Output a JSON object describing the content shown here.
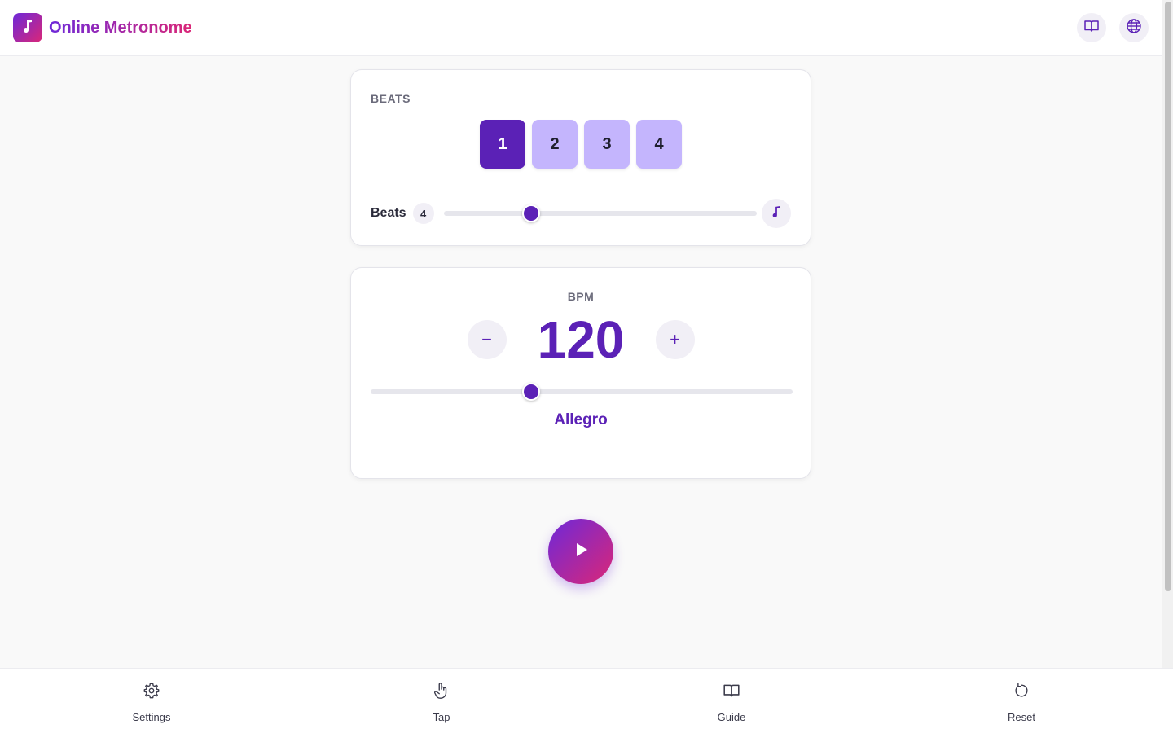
{
  "app": {
    "title": "Online Metronome"
  },
  "header": {
    "icons": [
      "book-icon",
      "globe-icon"
    ]
  },
  "beats_card": {
    "section_label": "BEATS",
    "beats": [
      "1",
      "2",
      "3",
      "4"
    ],
    "active_beat_index": 0,
    "control_label": "Beats",
    "count": "4",
    "slider_level": 0.28
  },
  "bpm_card": {
    "section_label": "BPM",
    "decrement_label": "−",
    "increment_label": "+",
    "value": "120",
    "slider_level": 0.38,
    "tempo_name": "Allegro"
  },
  "bottom_nav": {
    "settings": "Settings",
    "tap": "Tap",
    "guide": "Guide",
    "reset": "Reset"
  },
  "colors": {
    "accent": "#5b21b6",
    "beat_inactive": "#c4b5fd",
    "gradient_start": "#6d28d9",
    "gradient_end": "#db2777"
  }
}
